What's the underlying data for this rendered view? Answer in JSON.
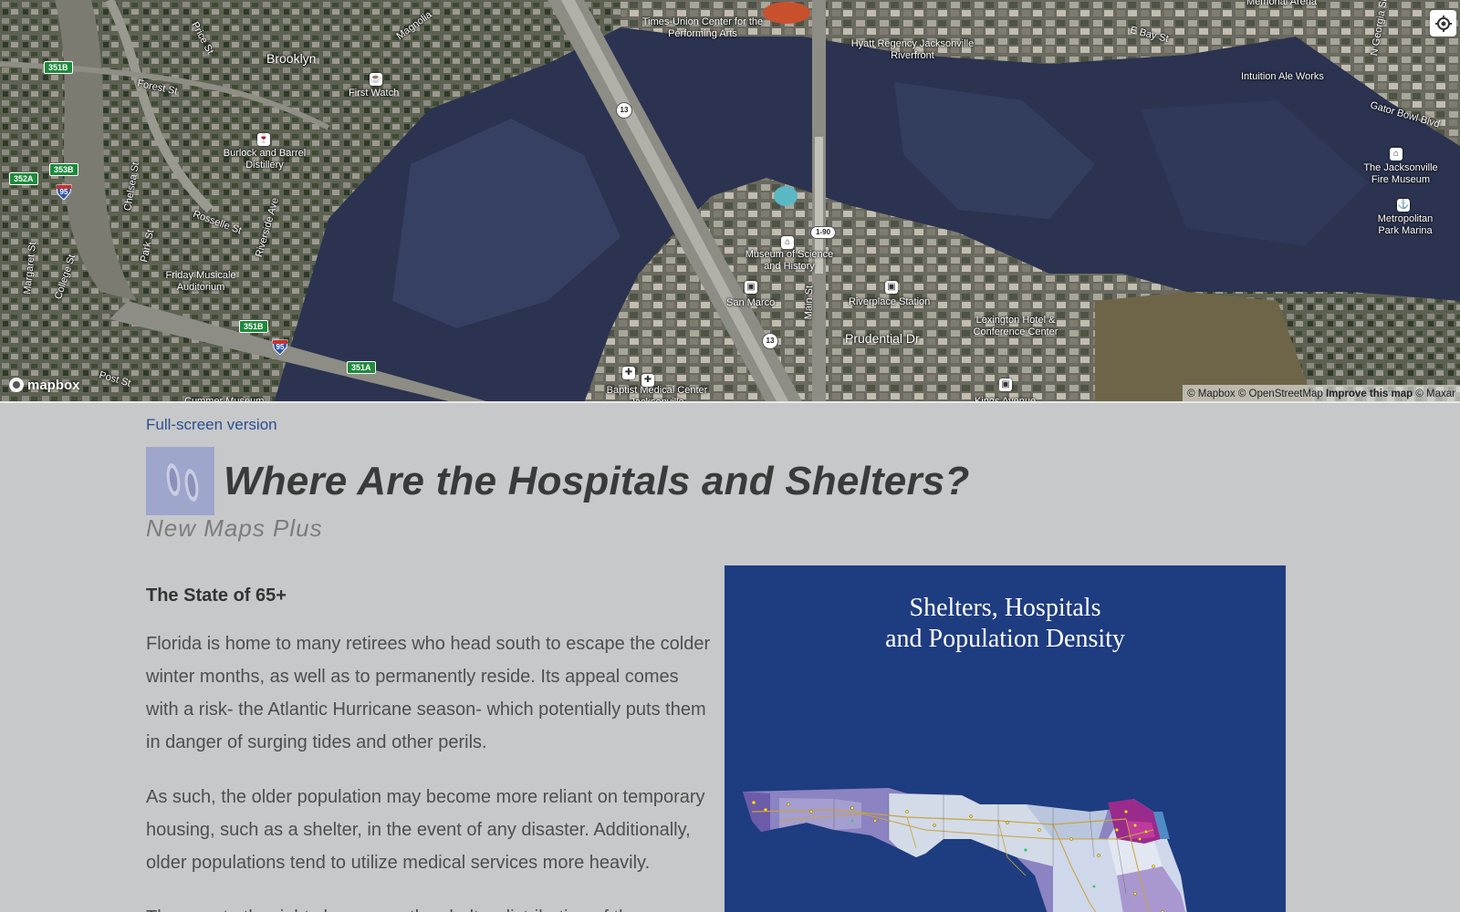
{
  "map": {
    "labels": {
      "times_union": "Times-Union Center for the Performing Arts",
      "hyatt": "Hyatt Regency Jacksonville Riverfront",
      "memorial_arena": "Memorial Arena",
      "e_bay_st": "E Bay St",
      "n_georgia_st": "N Georgia St",
      "intuition": "Intuition Ale Works",
      "gator_bowl": "Gator Bowl Blvd",
      "jax_fire_museum": "The Jacksonville Fire Museum",
      "metropolitan_park": "Metropolitan Park Marina",
      "brooklyn": "Brooklyn",
      "first_watch": "First Watch",
      "forest_st": "Forest St",
      "burlock": "Burlock and Barrel Distillery",
      "chelsea_st": "Chelsea St",
      "price_st": "Price St",
      "magnolia": "Magnolia",
      "rosselle_st": "Rosselle St",
      "riverside_ave": "Riverside Ave",
      "park_st": "Park St",
      "college_st": "College St",
      "margaret_st": "Margaret St",
      "friday_musicale": "Friday Musicale Auditorium",
      "post_st": "Post St",
      "cummer": "Cummer Museum",
      "museum_science": "Museum of Science and History",
      "san_marco": "San Marco",
      "riverplace": "Riverplace Station",
      "main_st": "Main St",
      "prudential": "Prudential Dr",
      "lexington": "Lexington Hotel & Conference Center",
      "kings_ave": "Kings Avenue",
      "baptist": "Baptist Medical Center Jacksonville"
    },
    "shields": {
      "s351b_top": "351B",
      "s352a": "352A",
      "s353b": "353B",
      "s351b_bottom": "351B",
      "s351a": "351A",
      "i95_a": "95",
      "i95_b": "95",
      "r13_a": "13",
      "r13_b": "13",
      "i90": "1-90"
    },
    "attribution": {
      "mapbox": "© Mapbox",
      "osm": "© OpenStreetMap",
      "improve": "Improve this map",
      "maxar": "© Maxar"
    },
    "logo_text": "mapbox"
  },
  "page": {
    "fullscreen_link": "Full-screen version",
    "title": "Where Are the Hospitals and Shelters?",
    "subtitle": "New Maps Plus",
    "section_heading": "The State of 65+",
    "paragraph_1": "Florida is home to many retirees who head south to escape the colder winter months, as well as to permanently reside. Its appeal comes with a risk- the Atlantic Hurricane season- which potentially puts them in danger of surging tides and other perils.",
    "paragraph_2": "As such, the older population may become more reliant on temporary housing, such as a shelter, in the event of any disaster. Additionally, older populations tend to utilize medical services more heavily.",
    "paragraph_3": "The map to the right showcases the shelter distribution of the"
  },
  "figure": {
    "title_line1": "Shelters, Hospitals",
    "title_line2": "and Population Density"
  },
  "colors": {
    "page_bg": "#c7c8c9",
    "link": "#2c4f8f",
    "figure_bg": "#1e3c80",
    "shield_green": "#1d8a3b"
  }
}
